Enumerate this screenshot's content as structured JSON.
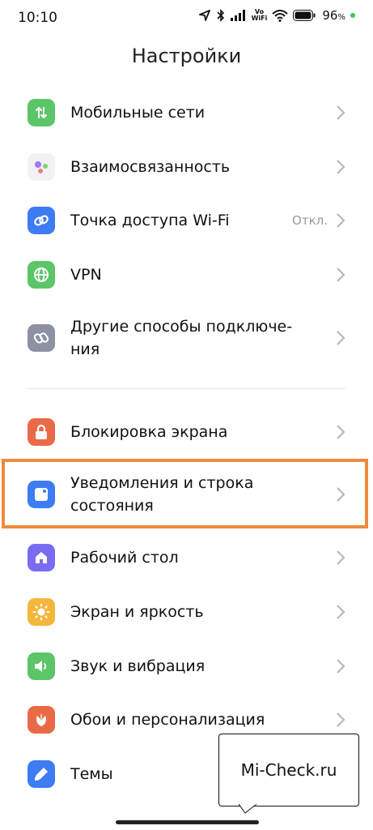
{
  "status_bar": {
    "time": "10:10",
    "battery": "96",
    "battery_unit": "%",
    "volte_top": "Vo",
    "volte_bottom": "WiFi"
  },
  "header": {
    "title": "Настройки"
  },
  "items": [
    {
      "label": "Мобильные сети",
      "icon": "arrows-updown-icon",
      "color": "#5bc568"
    },
    {
      "label": "Взаимосвязанность",
      "icon": "dots-icon",
      "color": "#f2f2f5"
    },
    {
      "label": "Точка доступа Wi-Fi",
      "value": "Откл.",
      "icon": "link-icon",
      "color": "#3d7cf3"
    },
    {
      "label": "VPN",
      "icon": "globe-icon",
      "color": "#5bc568"
    },
    {
      "label_line1": "Другие способы подключе-",
      "label_line2": "ния",
      "icon": "chain-icon",
      "color": "#8e91a4"
    },
    {
      "label": "Блокировка экрана",
      "icon": "lock-icon",
      "color": "#ea6a45"
    },
    {
      "label_line1": "Уведомления и строка",
      "label_line2": "состояния",
      "icon": "notification-icon",
      "color": "#3d7cf3"
    },
    {
      "label": "Рабочий стол",
      "icon": "home-icon",
      "color": "#7a6cf0"
    },
    {
      "label": "Экран и яркость",
      "icon": "sun-icon",
      "color": "#f5b73b"
    },
    {
      "label": "Звук и вибрация",
      "icon": "speaker-icon",
      "color": "#5bc568"
    },
    {
      "label": "Обои и персонализация",
      "icon": "flower-icon",
      "color": "#ea6a45"
    },
    {
      "label": "Темы",
      "icon": "brush-icon",
      "color": "#3d7cf3"
    }
  ],
  "watermark": {
    "text": "Mi-Check.ru"
  },
  "highlight_color": "#ef8a3d"
}
